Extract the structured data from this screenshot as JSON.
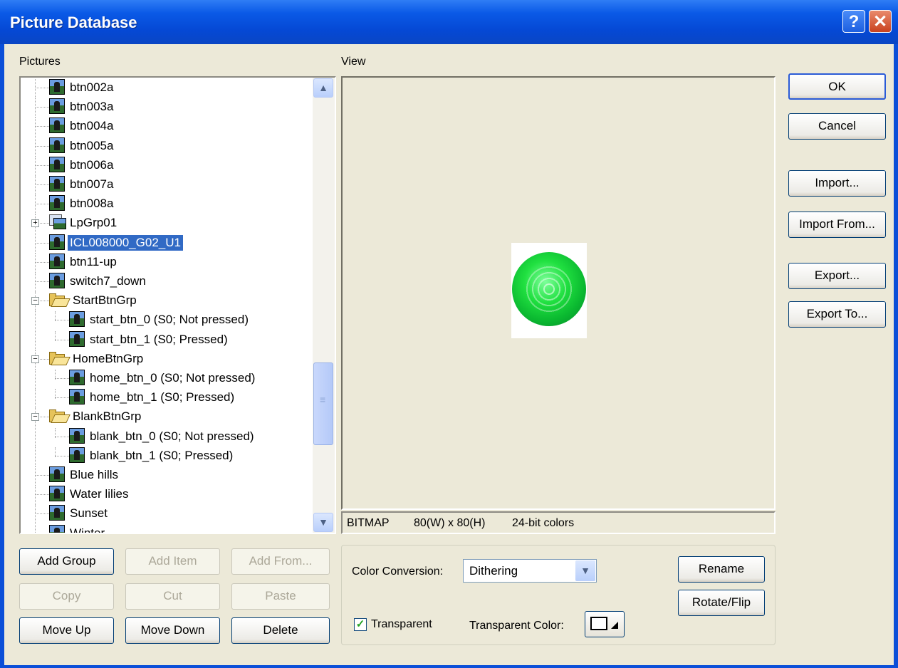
{
  "window": {
    "title": "Picture Database",
    "help_label": "?",
    "close_label": "✕"
  },
  "labels": {
    "pictures": "Pictures",
    "view": "View"
  },
  "tree": {
    "items": [
      {
        "label": "btn002a",
        "type": "picture",
        "level": 1
      },
      {
        "label": "btn003a",
        "type": "picture",
        "level": 1
      },
      {
        "label": "btn004a",
        "type": "picture",
        "level": 1
      },
      {
        "label": "btn005a",
        "type": "picture",
        "level": 1
      },
      {
        "label": "btn006a",
        "type": "picture",
        "level": 1
      },
      {
        "label": "btn007a",
        "type": "picture",
        "level": 1
      },
      {
        "label": "btn008a",
        "type": "picture",
        "level": 1
      },
      {
        "label": "LpGrp01",
        "type": "multi",
        "level": 1,
        "expander": "+"
      },
      {
        "label": "ICL008000_G02_U1",
        "type": "picture",
        "level": 1,
        "selected": true
      },
      {
        "label": "btn11-up",
        "type": "picture",
        "level": 1
      },
      {
        "label": "switch7_down",
        "type": "picture",
        "level": 1
      },
      {
        "label": "StartBtnGrp",
        "type": "folder",
        "level": 1,
        "expander": "−"
      },
      {
        "label": "start_btn_0 (S0; Not pressed)",
        "type": "picture",
        "level": 2
      },
      {
        "label": "start_btn_1 (S0; Pressed)",
        "type": "picture",
        "level": 2
      },
      {
        "label": "HomeBtnGrp",
        "type": "folder",
        "level": 1,
        "expander": "−"
      },
      {
        "label": "home_btn_0 (S0; Not pressed)",
        "type": "picture",
        "level": 2
      },
      {
        "label": "home_btn_1 (S0; Pressed)",
        "type": "picture",
        "level": 2
      },
      {
        "label": "BlankBtnGrp",
        "type": "folder",
        "level": 1,
        "expander": "−"
      },
      {
        "label": "blank_btn_0 (S0; Not pressed)",
        "type": "picture",
        "level": 2
      },
      {
        "label": "blank_btn_1 (S0; Pressed)",
        "type": "picture",
        "level": 2
      },
      {
        "label": "Blue hills",
        "type": "picture",
        "level": 1
      },
      {
        "label": "Water lilies",
        "type": "picture",
        "level": 1
      },
      {
        "label": "Sunset",
        "type": "picture",
        "level": 1
      },
      {
        "label": "Winter",
        "type": "picture",
        "level": 1
      }
    ]
  },
  "scrollbar": {
    "up": "▲",
    "down": "▼"
  },
  "left_buttons": {
    "add_group": "Add Group",
    "add_item": "Add Item",
    "add_from": "Add From...",
    "copy": "Copy",
    "cut": "Cut",
    "paste": "Paste",
    "move_up": "Move Up",
    "move_down": "Move Down",
    "delete": "Delete"
  },
  "right_buttons": {
    "ok": "OK",
    "cancel": "Cancel",
    "import": "Import...",
    "import_from": "Import From...",
    "export": "Export...",
    "export_to": "Export To..."
  },
  "status": {
    "format": "BITMAP",
    "size": "80(W) x 80(H)",
    "colors": "24-bit colors"
  },
  "options": {
    "color_conversion_label": "Color Conversion:",
    "color_conversion_value": "Dithering",
    "transparent_label": "Transparent",
    "transparent_checked": true,
    "transparent_color_label": "Transparent Color:",
    "rename": "Rename",
    "rotate_flip": "Rotate/Flip"
  },
  "colors": {
    "title_bar": "#0548d4",
    "selection": "#316ac5",
    "dialog_bg": "#ece9d8",
    "preview_green": "#20e040"
  }
}
